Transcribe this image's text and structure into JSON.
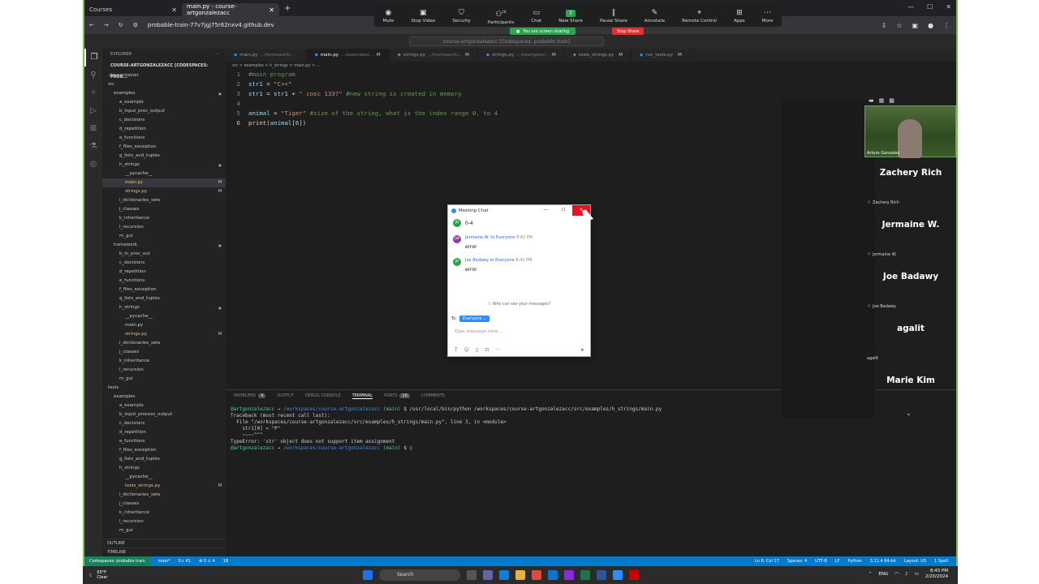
{
  "browser": {
    "tabs": [
      {
        "label": "Courses",
        "active": false
      },
      {
        "label": "main.py - course-artgonzalezacc",
        "active": true
      }
    ],
    "url": "probable-train-77v7jgj75r62nxv4.github.dev"
  },
  "zoom_toolbar": {
    "items": [
      "Mute",
      "Stop Video",
      "Security",
      "Participants",
      "Chat",
      "New Share",
      "Pause Share",
      "Annotate",
      "Remote Control",
      "Apps",
      "More"
    ],
    "participants_count": "18",
    "sharing_text": "You are screen sharing",
    "stop_share": "Stop Share"
  },
  "vscode": {
    "command_center": "course-artgonzalezacc [Codespaces: probable train]",
    "explorer_title": "EXPLORER",
    "workspace": "COURSE-ARTGONZALEZACC [CODESPACES: PROB...",
    "tree": [
      {
        "label": ".devcontainer",
        "indent": 1,
        "type": "folder"
      },
      {
        "label": "src",
        "indent": 1,
        "type": "folder"
      },
      {
        "label": "examples",
        "indent": 2,
        "type": "folder",
        "mark": "dot"
      },
      {
        "label": "a_example",
        "indent": 3,
        "type": "folder"
      },
      {
        "label": "b_input_proc_output",
        "indent": 3,
        "type": "folder"
      },
      {
        "label": "c_decisions",
        "indent": 3,
        "type": "folder"
      },
      {
        "label": "d_repetition",
        "indent": 3,
        "type": "folder"
      },
      {
        "label": "e_functions",
        "indent": 3,
        "type": "folder"
      },
      {
        "label": "f_files_exception",
        "indent": 3,
        "type": "folder"
      },
      {
        "label": "g_lists_and_tuples",
        "indent": 3,
        "type": "folder"
      },
      {
        "label": "h_strings",
        "indent": 3,
        "type": "folder",
        "mark": "dot"
      },
      {
        "label": "__pycache__",
        "indent": 4,
        "type": "folder"
      },
      {
        "label": "main.py",
        "indent": 4,
        "type": "file",
        "mark": "M",
        "selected": true
      },
      {
        "label": "strings.py",
        "indent": 4,
        "type": "file",
        "mark": "M"
      },
      {
        "label": "i_dictionaries_sets",
        "indent": 3,
        "type": "folder"
      },
      {
        "label": "j_classes",
        "indent": 3,
        "type": "folder"
      },
      {
        "label": "k_inheritance",
        "indent": 3,
        "type": "folder"
      },
      {
        "label": "l_recursion",
        "indent": 3,
        "type": "folder"
      },
      {
        "label": "m_gui",
        "indent": 3,
        "type": "folder"
      },
      {
        "label": "homework",
        "indent": 2,
        "type": "folder",
        "mark": "dot"
      },
      {
        "label": "b_in_proc_out",
        "indent": 3,
        "type": "folder"
      },
      {
        "label": "c_decisions",
        "indent": 3,
        "type": "folder"
      },
      {
        "label": "d_repetition",
        "indent": 3,
        "type": "folder"
      },
      {
        "label": "e_functions",
        "indent": 3,
        "type": "folder"
      },
      {
        "label": "f_files_exception",
        "indent": 3,
        "type": "folder"
      },
      {
        "label": "g_lists_and_tuples",
        "indent": 3,
        "type": "folder"
      },
      {
        "label": "h_strings",
        "indent": 3,
        "type": "folder",
        "mark": "dot"
      },
      {
        "label": "__pycache__",
        "indent": 4,
        "type": "folder"
      },
      {
        "label": "main.py",
        "indent": 4,
        "type": "file"
      },
      {
        "label": "strings.py",
        "indent": 4,
        "type": "file",
        "mark": "M"
      },
      {
        "label": "i_dictionaries_sets",
        "indent": 3,
        "type": "folder"
      },
      {
        "label": "j_classes",
        "indent": 3,
        "type": "folder"
      },
      {
        "label": "k_inheritance",
        "indent": 3,
        "type": "folder"
      },
      {
        "label": "l_recursion",
        "indent": 3,
        "type": "folder"
      },
      {
        "label": "m_gui",
        "indent": 3,
        "type": "folder"
      },
      {
        "label": "tests",
        "indent": 1,
        "type": "folder"
      },
      {
        "label": "examples",
        "indent": 2,
        "type": "folder"
      },
      {
        "label": "a_example",
        "indent": 3,
        "type": "folder"
      },
      {
        "label": "b_input_process_output",
        "indent": 3,
        "type": "folder"
      },
      {
        "label": "c_decisions",
        "indent": 3,
        "type": "folder"
      },
      {
        "label": "d_repetition",
        "indent": 3,
        "type": "folder"
      },
      {
        "label": "e_functions",
        "indent": 3,
        "type": "folder"
      },
      {
        "label": "f_files_exception",
        "indent": 3,
        "type": "folder"
      },
      {
        "label": "g_lists_and_tuples",
        "indent": 3,
        "type": "folder"
      },
      {
        "label": "h_strings",
        "indent": 3,
        "type": "folder"
      },
      {
        "label": "__pycache__",
        "indent": 4,
        "type": "folder"
      },
      {
        "label": "tests_strings.py",
        "indent": 4,
        "type": "file",
        "mark": "M"
      },
      {
        "label": "i_dictionaries_sets",
        "indent": 3,
        "type": "folder"
      },
      {
        "label": "j_classes",
        "indent": 3,
        "type": "folder"
      },
      {
        "label": "k_inheritance",
        "indent": 3,
        "type": "folder"
      },
      {
        "label": "l_recursion",
        "indent": 3,
        "type": "folder"
      },
      {
        "label": "m_gui",
        "indent": 3,
        "type": "folder"
      }
    ],
    "outline": "OUTLINE",
    "timeline": "TIMELINE",
    "editor_tabs": [
      {
        "label": "main.py",
        "path": ".../homework/...",
        "mark": "",
        "active": false
      },
      {
        "label": "main.py",
        "path": ".../examples/...",
        "mark": "M",
        "active": true
      },
      {
        "label": "strings.py",
        "path": ".../homework/...",
        "mark": "M",
        "active": false
      },
      {
        "label": "strings.py",
        "path": ".../examples/...",
        "mark": "M",
        "active": false
      },
      {
        "label": "tests_strings.py",
        "path": "",
        "mark": "M",
        "active": false
      },
      {
        "label": "run_tests.py",
        "path": "",
        "mark": "M",
        "active": false
      }
    ],
    "breadcrumbs": "src > examples > h_strings > main.py > ...",
    "code_lines": [
      {
        "num": "1",
        "html": "<span class='cm'>#main program</span>"
      },
      {
        "num": "2",
        "html": "<span class='vr'>str1</span> = <span class='st'>\"C++\"</span>"
      },
      {
        "num": "3",
        "html": "<span class='vr'>str1</span> = <span class='vr'>str1</span> + <span class='st'>\" cosc 1337\"</span> <span class='cm'>#new string is created in memory</span>"
      },
      {
        "num": "4",
        "html": ""
      },
      {
        "num": "5",
        "html": "<span class='vr'>animal</span> = <span class='st'>\"Tiger\"</span> <span class='cm'>#size of the string, what is the index range 0, to 4</span>"
      },
      {
        "num": "6",
        "html": "<span class='fn'>print</span>(<span class='vr'>animal</span>[<span class='nm'>6</span>])"
      }
    ],
    "panel_tabs": [
      {
        "label": "PROBLEMS",
        "badge": "4"
      },
      {
        "label": "OUTPUT",
        "badge": ""
      },
      {
        "label": "DEBUG CONSOLE",
        "badge": ""
      },
      {
        "label": "TERMINAL",
        "badge": "",
        "active": true
      },
      {
        "label": "PORTS",
        "badge": "18"
      },
      {
        "label": "COMMENTS",
        "badge": ""
      }
    ],
    "terminal": {
      "user": "@artgonzalezacc",
      "path": "/workspaces/course-artgonzalezacc",
      "branch": "(main)",
      "command": "$ /usr/local/bin/python /workspaces/course-artgonzalezacc/src/examples/h_strings/main.py",
      "lines": [
        "Traceback (most recent call last):",
        "  File \"/workspaces/course-artgonzalezacc/src/examples/h_strings/main.py\", line 3, in <module>",
        "    str1[0] = \"P\"",
        "    ~~~~^^^",
        "TypeError: 'str' object does not support item assignment"
      ],
      "prompt_end": "$ "
    },
    "statusbar": {
      "remote": "Codespaces: probable train",
      "branch": "main*",
      "sync": "0↓ 41",
      "problems": "⊗ 0 ⚠ 4",
      "ports": "18",
      "right": [
        "Ln 6, Col 17",
        "Spaces: 4",
        "UTF-8",
        "LF",
        "Python",
        "3.11.4 64-bit",
        "Layout: US",
        "1 Spell"
      ]
    }
  },
  "participants": {
    "video_name": "Arturo Gonzalez",
    "list": [
      {
        "big": "Zachery Rich",
        "small": "Zachery Rich"
      },
      {
        "big": "Jermaine W.",
        "small": "Jermaine W."
      },
      {
        "big": "Joe Badawy",
        "small": "Joe Badawy"
      },
      {
        "big": "agalit",
        "small": "agalit"
      },
      {
        "big": "Marie Kim",
        "small": ""
      }
    ]
  },
  "chat": {
    "title": "Meeting Chat",
    "first_text": "0-4",
    "messages": [
      {
        "initials": "JW",
        "sender": "Jermaine W.",
        "to": "to Everyone",
        "time": "8:42 PM",
        "text": "error"
      },
      {
        "initials": "JB",
        "sender": "Joe Badawy",
        "to": "to Everyone",
        "time": "8:42 PM",
        "text": "error"
      }
    ],
    "who_can_see": "Who can see your messages?",
    "to_label": "To:",
    "to_value": "Everyone",
    "placeholder": "Type message here..."
  },
  "taskbar": {
    "temp": "65°F",
    "weather": "Clear",
    "search": "Search",
    "lang": "ENG",
    "time": "8:43 PM",
    "date": "2/20/2024"
  }
}
